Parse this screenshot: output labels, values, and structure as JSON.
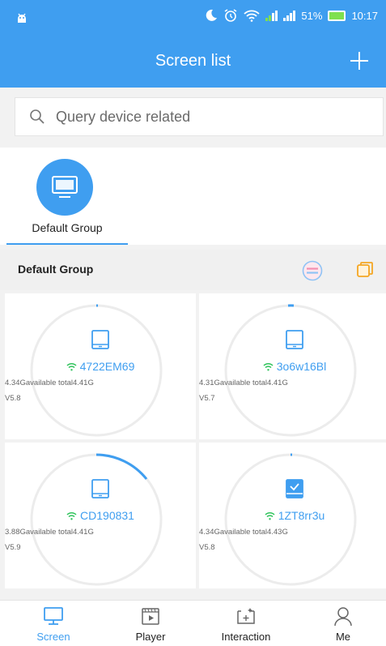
{
  "status_bar": {
    "battery": "51%",
    "time": "10:17"
  },
  "header": {
    "title": "Screen list"
  },
  "search": {
    "placeholder": "Query device related"
  },
  "groups": [
    {
      "label": "Default Group"
    }
  ],
  "section": {
    "title": "Default Group"
  },
  "devices": [
    {
      "name": "4722EM69",
      "storage": "4.34Gavailable total4.41G",
      "version": "V5.8",
      "online": true,
      "selected": false
    },
    {
      "name": "3o6w16Bl",
      "storage": "4.31Gavailable total4.41G",
      "version": "V5.7",
      "online": true,
      "selected": false
    },
    {
      "name": "CD190831",
      "storage": "3.88Gavailable total4.41G",
      "version": "V5.9",
      "online": true,
      "selected": false
    },
    {
      "name": "1ZT8rr3u",
      "storage": "4.34Gavailable total4.43G",
      "version": "V5.8",
      "online": true,
      "selected": true
    }
  ],
  "bottom_nav": [
    {
      "label": "Screen",
      "icon": "monitor-icon",
      "active": true
    },
    {
      "label": "Player",
      "icon": "player-icon",
      "active": false
    },
    {
      "label": "Interaction",
      "icon": "interaction-icon",
      "active": false
    },
    {
      "label": "Me",
      "icon": "person-icon",
      "active": false
    }
  ],
  "colors": {
    "primary": "#3f9ef0",
    "accent_orange": "#f5a623",
    "accent_pink": "#f38fb0",
    "wifi_green": "#2fc35b"
  }
}
